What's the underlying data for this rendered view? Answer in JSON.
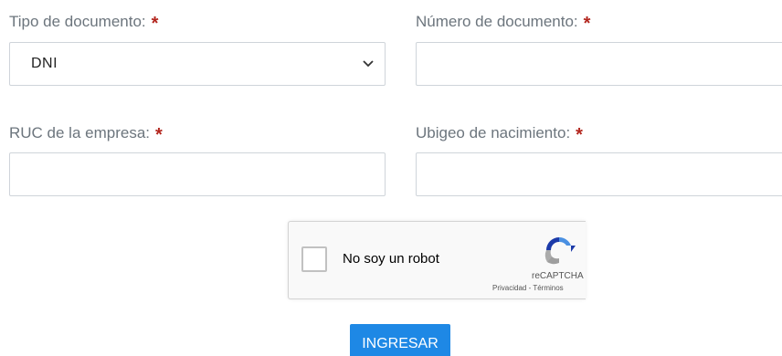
{
  "form": {
    "tipo_documento": {
      "label": "Tipo de documento:",
      "required_mark": "*",
      "selected": "DNI"
    },
    "numero_documento": {
      "label": "Número de documento:",
      "required_mark": "*",
      "value": ""
    },
    "ruc_empresa": {
      "label": "RUC de la empresa:",
      "required_mark": "*",
      "value": ""
    },
    "ubigeo_nacimiento": {
      "label": "Ubigeo de nacimiento:",
      "required_mark": "*",
      "value": ""
    }
  },
  "recaptcha": {
    "label": "No soy un robot",
    "brand": "reCAPTCHA",
    "links": "Privacidad - Términos",
    "checked": false
  },
  "submit": {
    "label": "INGRESAR"
  },
  "colors": {
    "required": "#b3261e",
    "button": "#1e88e5",
    "label": "#6c757d"
  }
}
